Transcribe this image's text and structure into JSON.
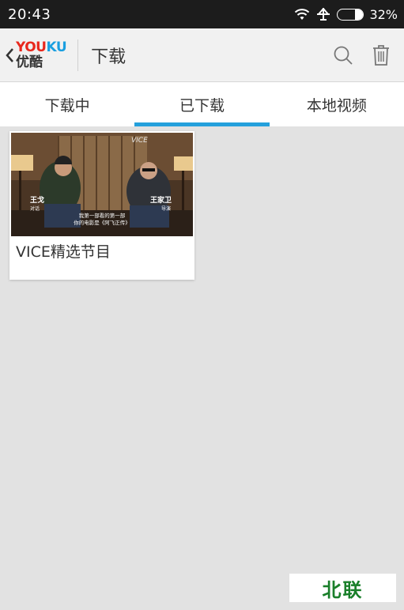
{
  "status_bar": {
    "time": "20:43",
    "battery_text": "32%",
    "battery_level": 0.32,
    "icons": [
      "wifi-icon",
      "airplane-icon",
      "battery-icon"
    ]
  },
  "header": {
    "logo_en_you": "YOU",
    "logo_en_ku": "KU",
    "logo_cn": "优酷",
    "title": "下载",
    "actions": [
      "search-icon",
      "trash-icon"
    ]
  },
  "tabs": [
    {
      "label": "下载中",
      "active": false
    },
    {
      "label": "已下载",
      "active": true
    },
    {
      "label": "本地视频",
      "active": false
    }
  ],
  "downloads": [
    {
      "title": "VICE精选节目",
      "thumbnail": {
        "left_name": "王戈",
        "left_role": "对话",
        "right_name": "王家卫",
        "right_role": "导演",
        "subtitle_line1": "我第一部看的第一部",
        "subtitle_line2": "你的电影是《阿飞正传》",
        "corner_logo": "VICE"
      }
    }
  ],
  "watermark": "北联",
  "colors": {
    "accent": "#24a0dc",
    "youku_red": "#e8281d",
    "youku_blue": "#1a9fe0",
    "status_bar_bg": "#1c1c1c",
    "background": "#e2e2e2",
    "watermark_text": "#1a7f2a"
  }
}
